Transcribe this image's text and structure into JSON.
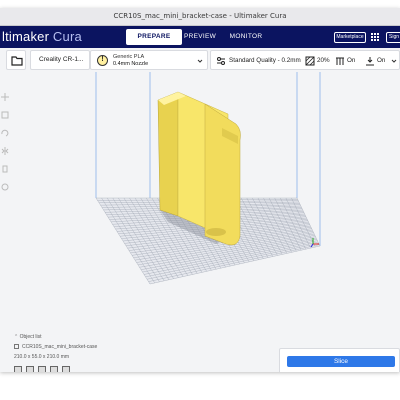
{
  "window": {
    "title": "CCR10S_mac_mini_bracket-case - Ultimaker Cura"
  },
  "app": {
    "brand_strong": "ltimaker",
    "brand_light": " Cura"
  },
  "stages": {
    "prepare": "PREPARE",
    "preview": "PREVIEW",
    "monitor": "MONITOR"
  },
  "header": {
    "marketplace": "Marketplace",
    "signin": "Sign in"
  },
  "printer": {
    "name": "Creality CR-1..."
  },
  "material": {
    "name": "Generic PLA",
    "nozzle": "0.4mm Nozzle"
  },
  "print_settings": {
    "quality": "Standard Quality - 0.2mm",
    "infill": "20%",
    "support": "On",
    "adhesion": "On"
  },
  "object_list": {
    "header": "Object list",
    "item": "CCR10S_mac_mini_bracket-case",
    "dimensions": "210.0 x 55.0 x 210.0 mm"
  },
  "slice": {
    "label": "Slice"
  },
  "colors": {
    "appbar": "#0b1460",
    "model": "#f8e66a",
    "accent": "#2e78e8"
  },
  "icons": [
    "folder-icon",
    "warning-icon",
    "quality-icon",
    "infill-icon",
    "support-icon",
    "adhesion-icon",
    "apps-grid-icon",
    "chevron-down-icon"
  ]
}
